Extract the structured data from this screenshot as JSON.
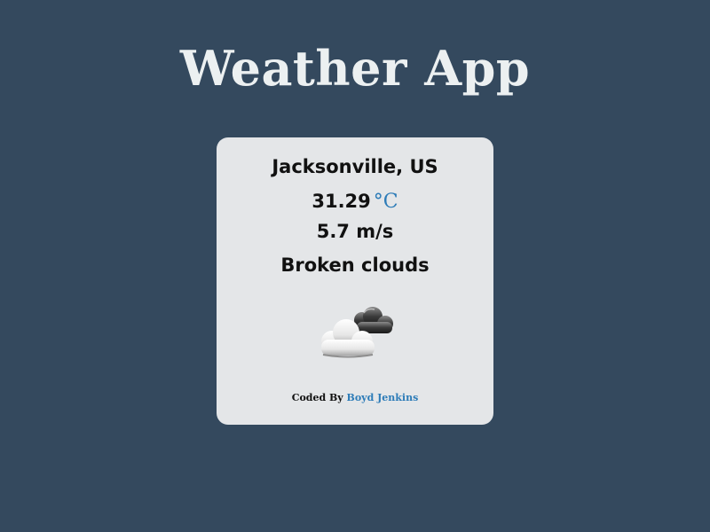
{
  "header": {
    "title": "Weather App"
  },
  "weather": {
    "location": "Jacksonville, US",
    "temperature": "31.29",
    "temperature_unit": "°C",
    "wind": "5.7 m/s",
    "description": "Broken clouds",
    "icon": "broken-clouds-icon"
  },
  "footer": {
    "credits_prefix": "Coded By",
    "author": "Boyd Jenkins"
  },
  "colors": {
    "background": "#34495e",
    "card": "#e4e6e8",
    "accent": "#2d7cb8",
    "title": "#ecf0f1"
  }
}
